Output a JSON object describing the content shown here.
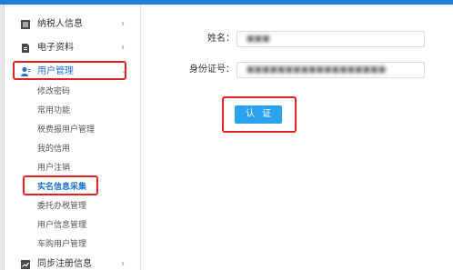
{
  "sidebar": {
    "items": [
      {
        "label": "纳税人信息",
        "icon": "document-list-icon"
      },
      {
        "label": "电子资料",
        "icon": "file-icon"
      },
      {
        "label": "用户管理",
        "icon": "user-icon"
      },
      {
        "label": "同步注册信息",
        "icon": "chart-line-icon"
      }
    ],
    "submenu": [
      {
        "label": "修改密码"
      },
      {
        "label": "常用功能"
      },
      {
        "label": "税费报用户管理"
      },
      {
        "label": "我的信用"
      },
      {
        "label": "用户注销"
      },
      {
        "label": "实名信息采集"
      },
      {
        "label": "委托办税管理"
      },
      {
        "label": "用户信息管理"
      },
      {
        "label": "车购用户管理"
      }
    ],
    "chevron_right": "›",
    "chevron_down": "⌄"
  },
  "form": {
    "name_label": "姓名：",
    "name_value": "■■■",
    "id_label": "身份证号：",
    "id_value": "■■■■■■■■■■■■■■■■■■",
    "submit_label": "认证"
  },
  "colors": {
    "accent": "#1f7fd6",
    "button": "#2aa2ee",
    "highlight": "#e0241f",
    "active_text": "#1f6fd0"
  }
}
